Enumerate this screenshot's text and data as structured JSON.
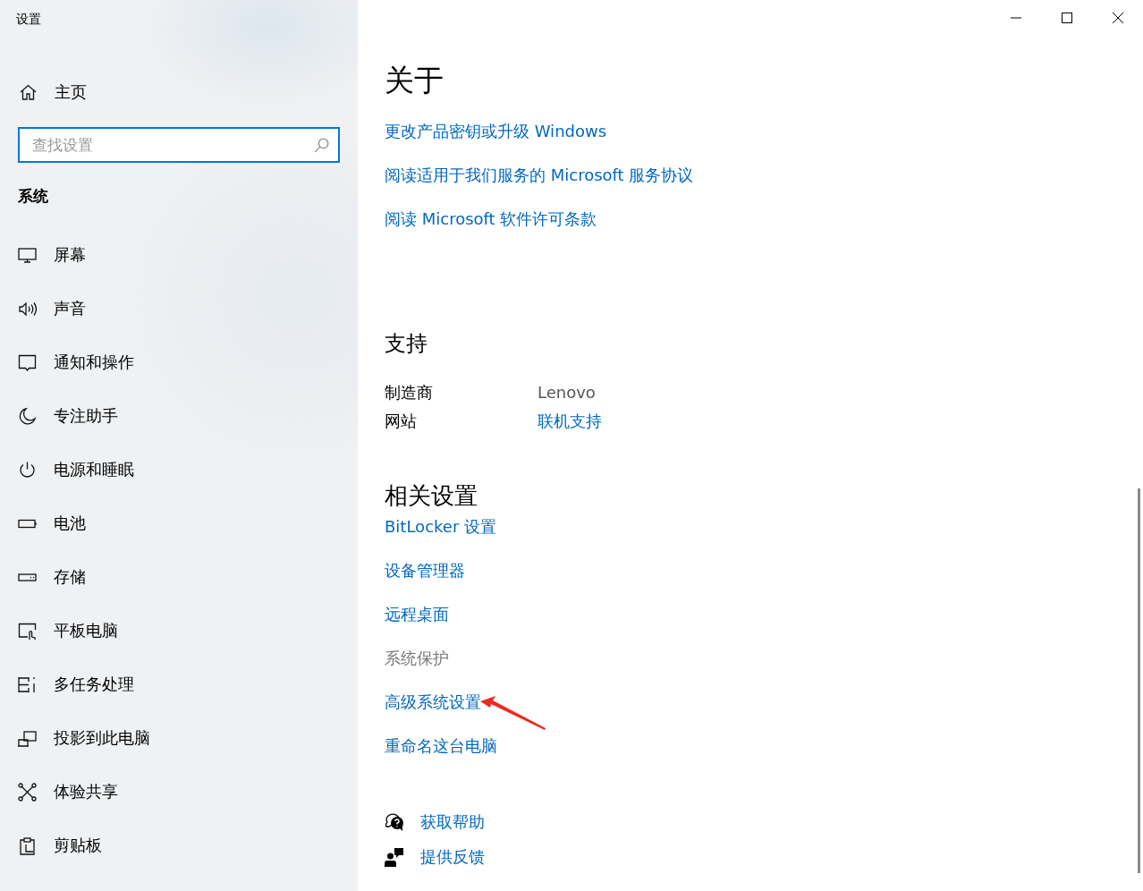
{
  "window": {
    "title": "设置"
  },
  "sidebar": {
    "home": "主页",
    "search": {
      "placeholder": "查找设置"
    },
    "section": "系统",
    "items": [
      {
        "label": "屏幕",
        "selected": false
      },
      {
        "label": "声音",
        "selected": false
      },
      {
        "label": "通知和操作",
        "selected": false
      },
      {
        "label": "专注助手",
        "selected": false
      },
      {
        "label": "电源和睡眠",
        "selected": false
      },
      {
        "label": "电池",
        "selected": false
      },
      {
        "label": "存储",
        "selected": false
      },
      {
        "label": "平板电脑",
        "selected": false
      },
      {
        "label": "多任务处理",
        "selected": false
      },
      {
        "label": "投影到此电脑",
        "selected": false
      },
      {
        "label": "体验共享",
        "selected": false
      },
      {
        "label": "剪贴板",
        "selected": false
      }
    ]
  },
  "about": {
    "title": "关于",
    "links": [
      "更改产品密钥或升级 Windows",
      "阅读适用于我们服务的 Microsoft 服务协议",
      "阅读 Microsoft 软件许可条款"
    ]
  },
  "support": {
    "title": "支持",
    "rows": [
      {
        "label": "制造商",
        "value": "Lenovo",
        "kind": "text"
      },
      {
        "label": "网站",
        "value": "联机支持",
        "kind": "link"
      }
    ]
  },
  "related": {
    "title": "相关设置",
    "links": [
      {
        "label": "BitLocker 设置",
        "disabled": false
      },
      {
        "label": "设备管理器",
        "disabled": false
      },
      {
        "label": "远程桌面",
        "disabled": false
      },
      {
        "label": "系统保护",
        "disabled": true
      },
      {
        "label": "高级系统设置",
        "disabled": false
      },
      {
        "label": "重命名这台电脑",
        "disabled": false
      }
    ]
  },
  "help": [
    {
      "label": "获取帮助",
      "kind": "help"
    },
    {
      "label": "提供反馈",
      "kind": "feedback"
    }
  ]
}
